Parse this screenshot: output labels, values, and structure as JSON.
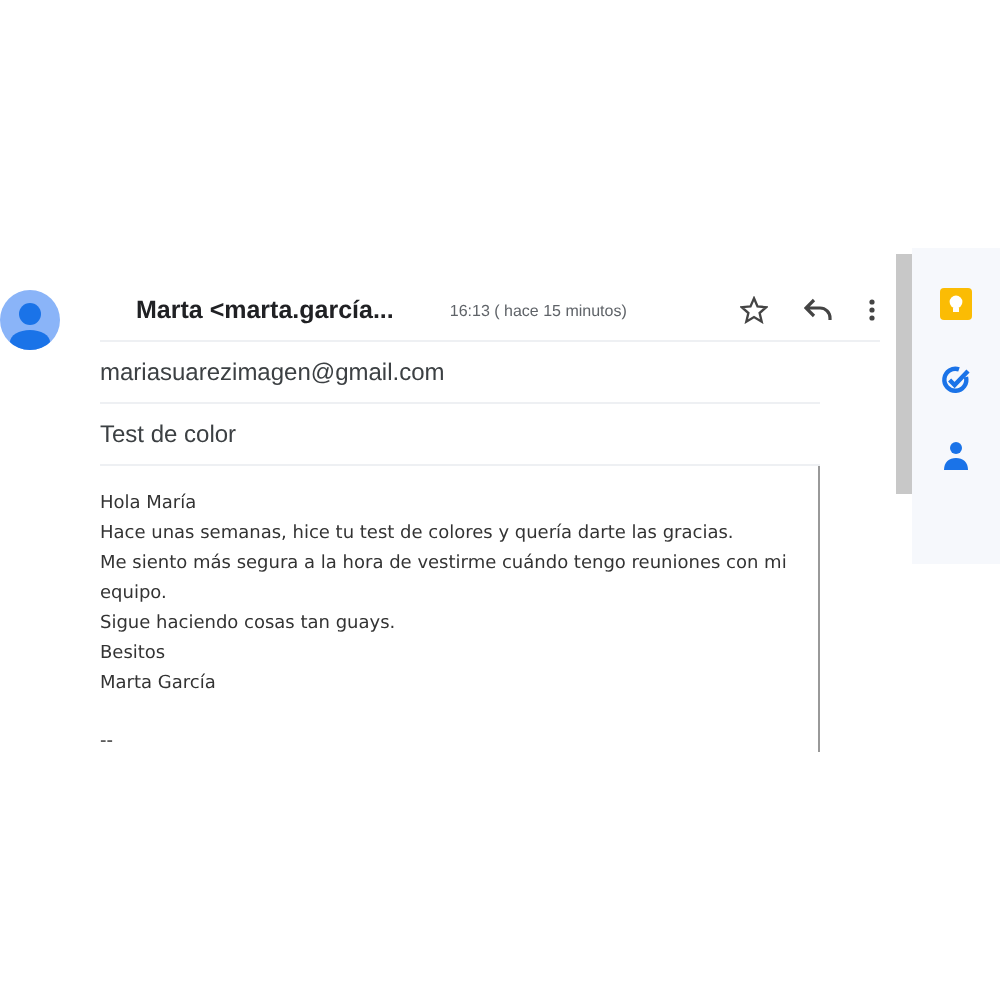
{
  "message": {
    "sender": "Marta <marta.garcía...",
    "time": "16:13 ( hace 15 minutos)",
    "starred": false,
    "to": "mariasuarezimagen@gmail.com",
    "subject": "Test de color",
    "body": [
      "Hola María",
      "Hace unas semanas, hice tu test de colores y quería darte las gracias.",
      "Me siento más segura a la hora de vestirme cuándo tengo reuniones con mi equipo.",
      "Sigue haciendo cosas tan guays.",
      "Besitos",
      "Marta García",
      {
        "text": "--",
        "gap_before": true
      }
    ]
  },
  "side_panel": {
    "apps": [
      {
        "kind": "keep"
      },
      {
        "kind": "tasks"
      },
      {
        "kind": "contacts"
      }
    ]
  }
}
